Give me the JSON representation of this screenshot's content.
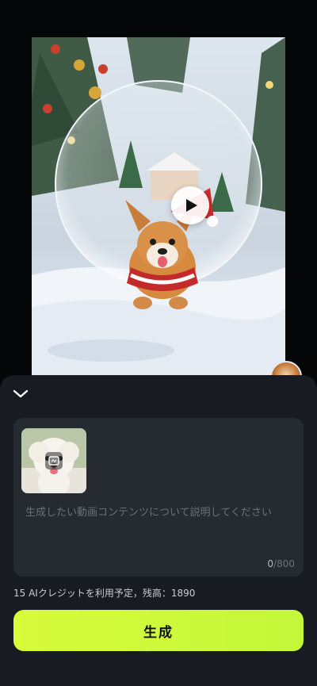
{
  "preview": {
    "play_icon": "play-icon",
    "description_icon": "snow-globe-corgi-thumbnail"
  },
  "sheet": {
    "collapse_icon": "chevron-down-icon",
    "prompt": {
      "placeholder": "生成したい動画コンテンツについて説明してください",
      "value": "",
      "count_current": "0",
      "count_max": "/800"
    },
    "reference_image_icon": "replace-image-icon",
    "credits_text": "15 AIクレジットを利用予定，残高：1890",
    "generate_label": "生成"
  },
  "colors": {
    "accent": "#ccf93a",
    "sheet_bg": "#181b21",
    "card_bg": "#262a31"
  }
}
